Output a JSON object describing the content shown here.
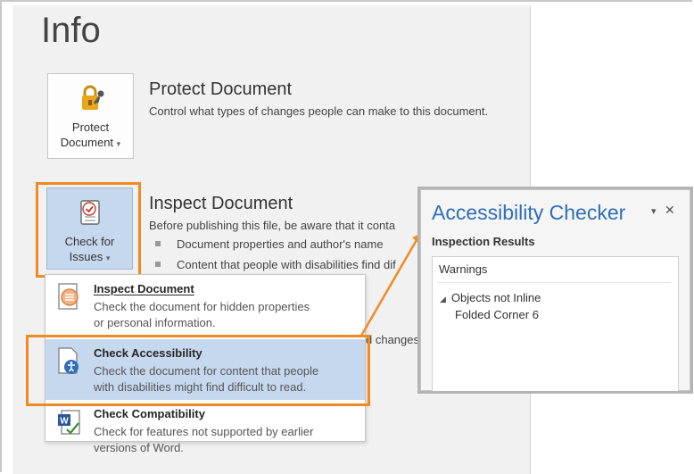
{
  "page": {
    "title": "Info"
  },
  "protect": {
    "button_line1": "Protect",
    "button_line2": "Document",
    "dropdown": "▾",
    "title": "Protect Document",
    "description": "Control what types of changes people can make to this document."
  },
  "inspect": {
    "button_line1": "Check for",
    "button_line2": "Issues",
    "dropdown": "▾",
    "title": "Inspect Document",
    "description": "Before publishing this file, be aware that it conta",
    "bullets": [
      "Document properties and author's name",
      "Content that people with disabilities find dif"
    ],
    "hidden_text": "d changes"
  },
  "menu": {
    "items": [
      {
        "title": "Inspect Document",
        "desc_line1": "Check the document for hidden properties",
        "desc_line2": "or personal information.",
        "icon": "inspect-document-icon"
      },
      {
        "title": "Check Accessibility",
        "desc_line1": "Check the document for content that people",
        "desc_line2": "with disabilities might find difficult to read.",
        "icon": "accessibility-icon"
      },
      {
        "title": "Check Compatibility",
        "desc_line1": "Check for features not supported by earlier",
        "desc_line2": "versions of Word.",
        "icon": "word-compatibility-icon"
      }
    ]
  },
  "panel": {
    "title": "Accessibility Checker",
    "subtitle": "Inspection Results",
    "heading": "Warnings",
    "category": "Objects not Inline",
    "category_toggle": "◢",
    "item": "Folded Corner 6",
    "dropdown_glyph": "▾",
    "close_glyph": "✕"
  },
  "colors": {
    "highlight_orange": "#f08a24",
    "selection_blue": "#c6d8ee",
    "panel_title_blue": "#2e6fb8",
    "backstage_gray": "#f1f1f1"
  }
}
